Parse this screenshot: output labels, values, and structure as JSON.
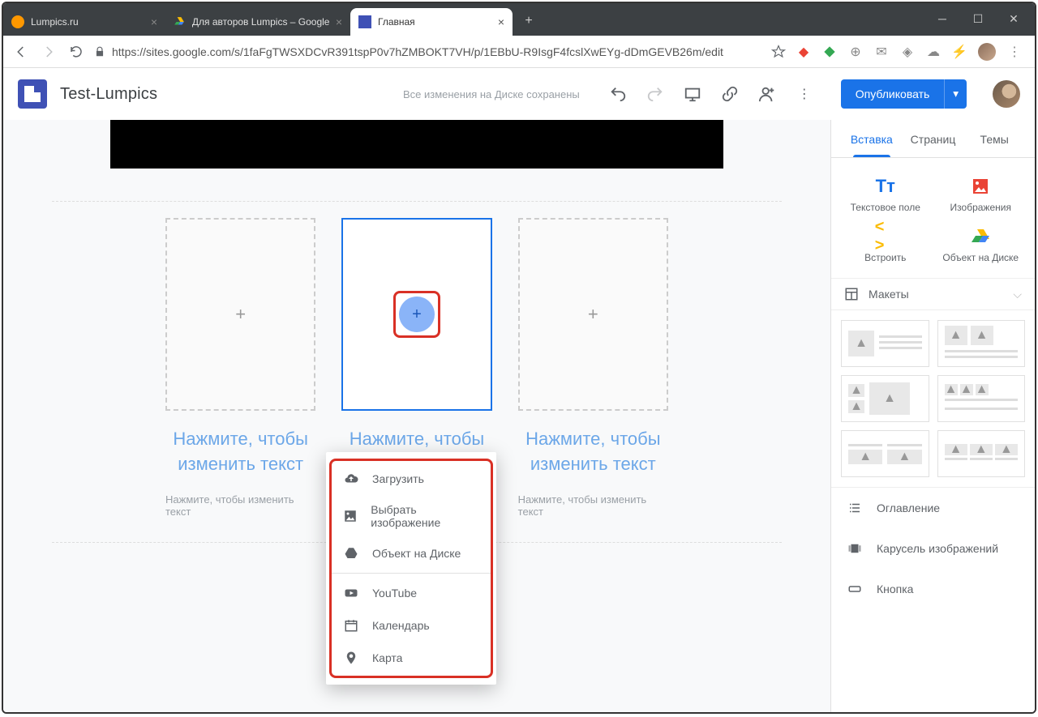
{
  "browser": {
    "tabs": [
      {
        "title": "Lumpics.ru",
        "active": false
      },
      {
        "title": "Для авторов Lumpics – Google Д",
        "active": false
      },
      {
        "title": "Главная",
        "active": true
      }
    ],
    "url": "https://sites.google.com/s/1faFgTWSXDCvR391tspP0v7hZMBOKT7VH/p/1EBbU-R9IsgF4fcslXwEYg-dDmGEVB26m/edit"
  },
  "app": {
    "doc_title": "Test-Lumpics",
    "save_status": "Все изменения на Диске сохранены",
    "publish_label": "Опубликовать"
  },
  "canvas": {
    "placeholder_title": "Нажмите, чтобы изменить текст",
    "placeholder_sub": "Нажмите, чтобы изменить текст"
  },
  "popup": {
    "items_a": [
      {
        "icon": "upload",
        "label": "Загрузить"
      },
      {
        "icon": "image",
        "label": "Выбрать изображение"
      },
      {
        "icon": "drive",
        "label": "Объект на Диске"
      }
    ],
    "items_b": [
      {
        "icon": "youtube",
        "label": "YouTube"
      },
      {
        "icon": "calendar",
        "label": "Календарь"
      },
      {
        "icon": "map",
        "label": "Карта"
      }
    ]
  },
  "sidebar": {
    "tabs": {
      "insert": "Вставка",
      "pages": "Страниц",
      "themes": "Темы"
    },
    "quick": {
      "text": "Текстовое поле",
      "images": "Изображения",
      "embed": "Встроить",
      "drive": "Объект на Диске"
    },
    "layouts_label": "Макеты",
    "list": {
      "toc": "Оглавление",
      "carousel": "Карусель изображений",
      "button": "Кнопка"
    }
  }
}
